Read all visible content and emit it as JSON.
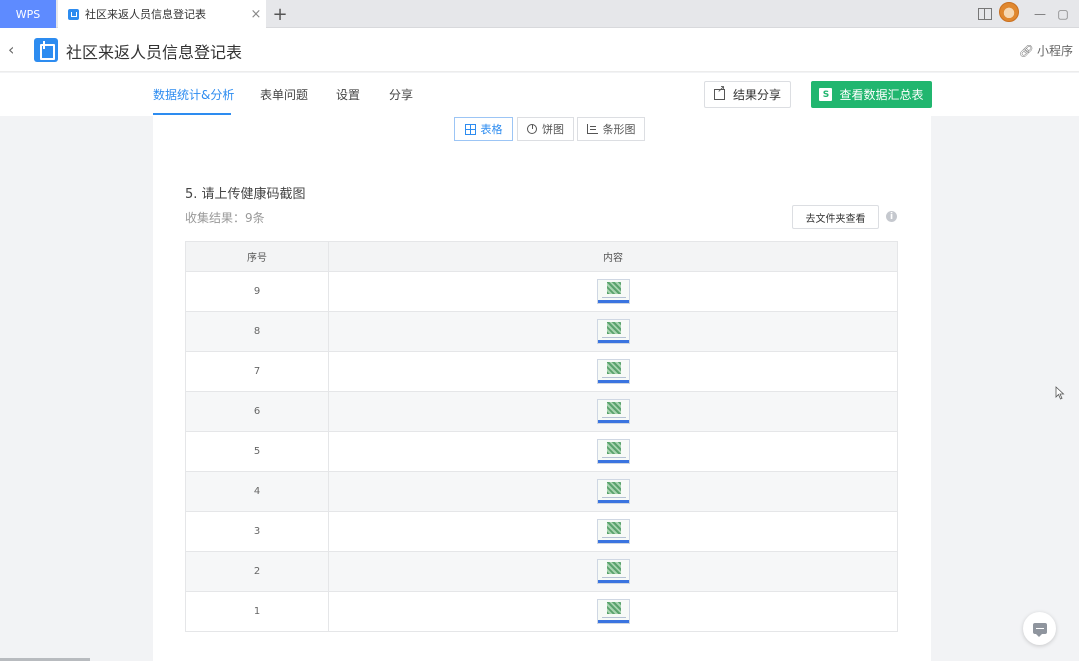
{
  "tabbar": {
    "wps_label": "WPS",
    "doc_tab_label": "社区来返人员信息登记表",
    "close_glyph": "×",
    "new_tab_glyph": "+"
  },
  "titlebar": {
    "back_glyph": "‹",
    "title": "社区来返人员信息登记表",
    "mini_program": "小程序"
  },
  "nav": {
    "tabs": [
      "数据统计&分析",
      "表单问题",
      "设置",
      "分享"
    ],
    "active_index": 0,
    "share_results": "结果分享",
    "view_summary": "查看数据汇总表",
    "summary_icon_letter": "S"
  },
  "views": {
    "table": "表格",
    "pie": "饼图",
    "bar": "条形图",
    "active": "table"
  },
  "question": {
    "title": "5. 请上传健康码截图",
    "collect_result": "收集结果：9条",
    "folder_button": "去文件夹查看",
    "info_glyph": "i"
  },
  "table": {
    "headers": [
      "序号",
      "内容"
    ],
    "rows": [
      {
        "index": "9"
      },
      {
        "index": "8"
      },
      {
        "index": "7"
      },
      {
        "index": "6"
      },
      {
        "index": "5"
      },
      {
        "index": "4"
      },
      {
        "index": "3"
      },
      {
        "index": "2"
      },
      {
        "index": "1"
      }
    ]
  },
  "colors": {
    "accent": "#2d8cf0",
    "wps_tab": "#5e8bff",
    "summary_button": "#21b66f"
  }
}
